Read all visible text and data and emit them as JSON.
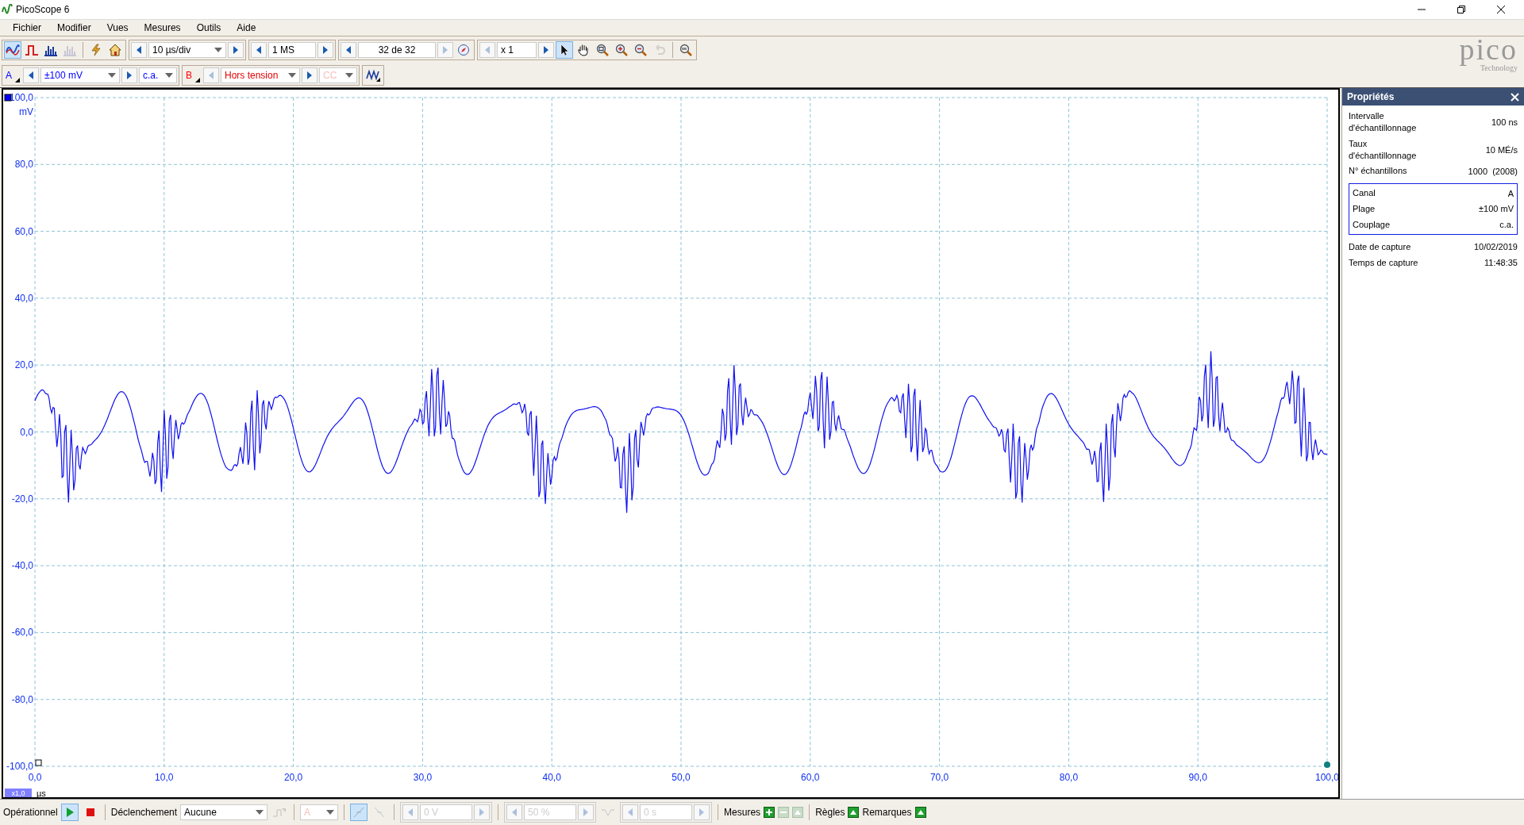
{
  "window": {
    "title": "PicoScope 6"
  },
  "menu": [
    "Fichier",
    "Modifier",
    "Vues",
    "Mesures",
    "Outils",
    "Aide"
  ],
  "toolbar": {
    "modes": [
      {
        "kind": "scope",
        "selected": true,
        "disabled": false
      },
      {
        "kind": "persistence",
        "selected": false,
        "disabled": false
      },
      {
        "kind": "spectrum",
        "selected": false,
        "disabled": false
      },
      {
        "kind": "spectrum",
        "selected": false,
        "disabled": true
      }
    ],
    "timebase": "10 µs/div",
    "samples": "1 MS",
    "buffer": "32 de 32",
    "zoom": "x 1",
    "tools": [
      {
        "kind": "pointer",
        "selected": true,
        "disabled": false
      },
      {
        "kind": "hand",
        "selected": false,
        "disabled": false
      },
      {
        "kind": "zoom_box",
        "selected": false,
        "disabled": false
      },
      {
        "kind": "zoom_in",
        "selected": false,
        "disabled": false
      },
      {
        "kind": "zoom_out",
        "selected": false,
        "disabled": false
      },
      {
        "kind": "undo",
        "selected": false,
        "disabled": true
      }
    ]
  },
  "logo": {
    "name": "pico",
    "tagline": "Technology"
  },
  "channels": [
    {
      "label": "A",
      "color": "#0000ff",
      "range": "±100 mV",
      "coupling": "c.a.",
      "enabled": true
    },
    {
      "label": "B",
      "color": "#ff0000",
      "range": "Hors tension",
      "coupling": "CC",
      "enabled": false
    }
  ],
  "scope": {
    "y_ticks": [
      "100,0",
      "80,0",
      "60,0",
      "40,0",
      "20,0",
      "0,0",
      "-20,0",
      "-40,0",
      "-60,0",
      "-80,0",
      "-100,0"
    ],
    "y_unit": "mV",
    "x_ticks": [
      "0,0",
      "10,0",
      "20,0",
      "30,0",
      "40,0",
      "50,0",
      "60,0",
      "70,0",
      "80,0",
      "90,0",
      "100,0"
    ],
    "x_unit": "µs",
    "zoom_badge": "x1,0"
  },
  "properties": {
    "title": "Propriétés",
    "rows": [
      {
        "label": "Intervalle d'échantillonnage",
        "value": "100 ns"
      },
      {
        "label": "Taux d'échantillonnage",
        "value": "10 MÉ/s"
      },
      {
        "label": "N° échantillons",
        "value": "1000  (2008)"
      }
    ],
    "channel_rows": [
      {
        "label": "Canal",
        "value": "A"
      },
      {
        "label": "Plage",
        "value": "±100 mV"
      },
      {
        "label": "Couplage",
        "value": "c.a."
      }
    ],
    "capture_rows": [
      {
        "label": "Date de capture",
        "value": "10/02/2019"
      },
      {
        "label": "Temps de capture",
        "value": "11:48:35"
      }
    ]
  },
  "status_bar": {
    "state": "Opérationnel",
    "running": true,
    "trigger_label": "Déclenchement",
    "trigger_mode": "Aucune",
    "trigger_channel": "A",
    "threshold": "0 V",
    "pretrigger": "50 %",
    "delay": "0 s",
    "measurements": "Mesures",
    "rulers": "Règles",
    "notes": "Remarques"
  }
}
